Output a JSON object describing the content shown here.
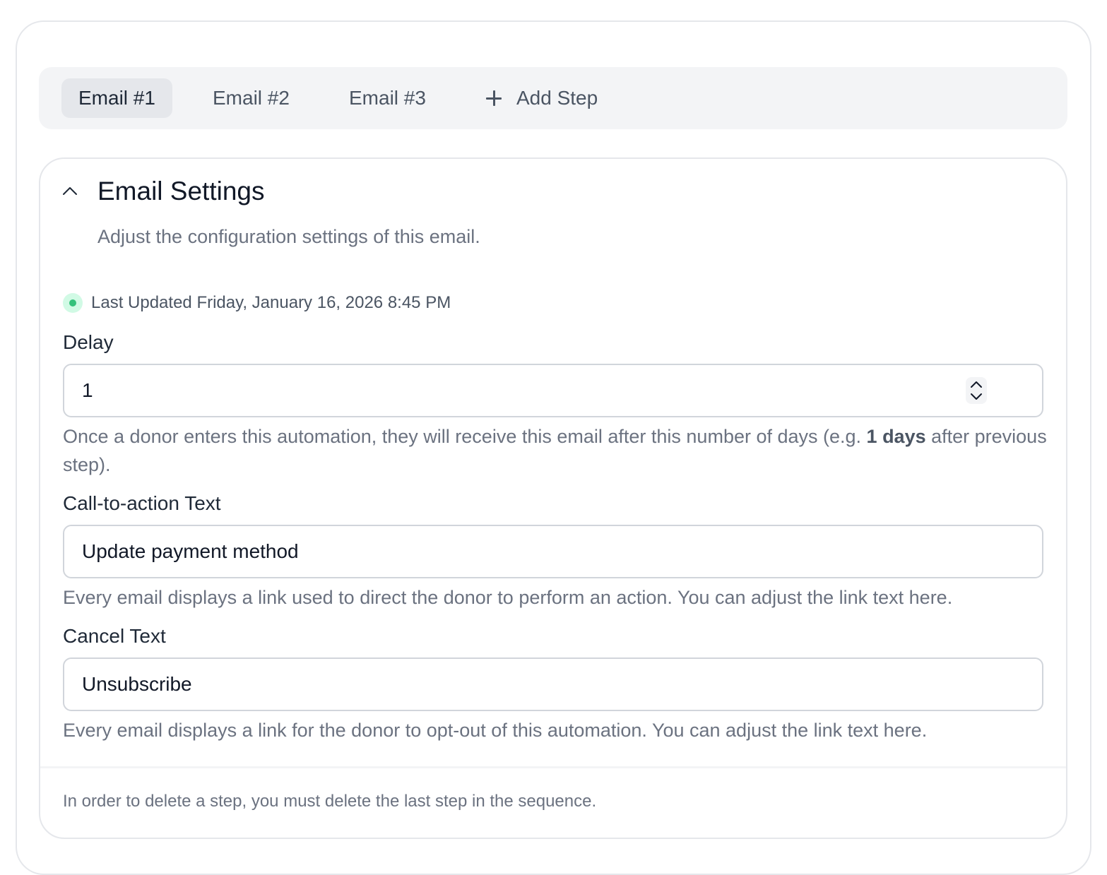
{
  "tabs": [
    {
      "label": "Email #1",
      "active": true
    },
    {
      "label": "Email #2",
      "active": false
    },
    {
      "label": "Email #3",
      "active": false
    }
  ],
  "add_step": {
    "label": "Add Step",
    "icon": "plus-icon"
  },
  "section": {
    "title": "Email Settings",
    "description": "Adjust the configuration settings of this email.",
    "toggle_icon": "chevron-up-icon"
  },
  "status": {
    "text": "Last Updated Friday, January 16, 2026 8:45 PM",
    "color": "#34c17b"
  },
  "fields": {
    "delay": {
      "label": "Delay",
      "value": "1",
      "help_prefix": "Once a donor enters this automation, they will receive this email after this number of days (e.g. ",
      "help_bold": "1 days",
      "help_suffix": " after previous step)."
    },
    "cta": {
      "label": "Call-to-action Text",
      "value": "Update payment method",
      "help": "Every email displays a link used to direct the donor to perform an action. You can adjust the link text here."
    },
    "cancel": {
      "label": "Cancel Text",
      "value": "Unsubscribe",
      "help": "Every email displays a link for the donor to opt-out of this automation. You can adjust the link text here."
    }
  },
  "footer": {
    "note": "In order to delete a step, you must delete the last step in the sequence."
  }
}
